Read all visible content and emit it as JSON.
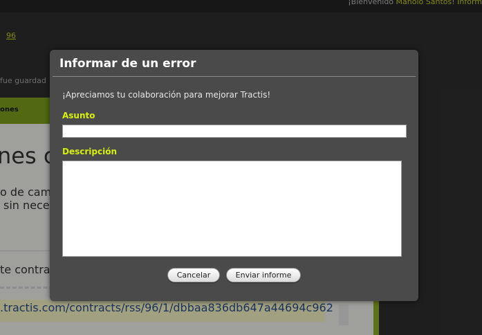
{
  "header": {
    "welcome_prefix": "¡Bienvenido ",
    "user_name": "Manolo Santos",
    "separator": "! ",
    "info_link": "Inform"
  },
  "background": {
    "page_number_link": "96",
    "saved_message": "fue guardad",
    "section_label": "ones",
    "heading_fragment": "nes c",
    "line1": "o de camb",
    "line2": "sin neces",
    "line3": "te contrato",
    "rss_url": ".tractis.com/contracts/rss/96/1/dbbaa836db647a44694c962"
  },
  "dialog": {
    "title": "Informar de un error",
    "intro": "¡Apreciamos tu colaboración para mejorar Tractis!",
    "subject_label": "Asunto",
    "subject_value": "",
    "description_label": "Descripción",
    "description_value": "",
    "cancel_label": "Cancelar",
    "send_label": "Enviar informe"
  },
  "colors": {
    "accent": "#d6f00a",
    "dialog_bg": "#4a4a4a",
    "page_green": "#7fa01c"
  }
}
